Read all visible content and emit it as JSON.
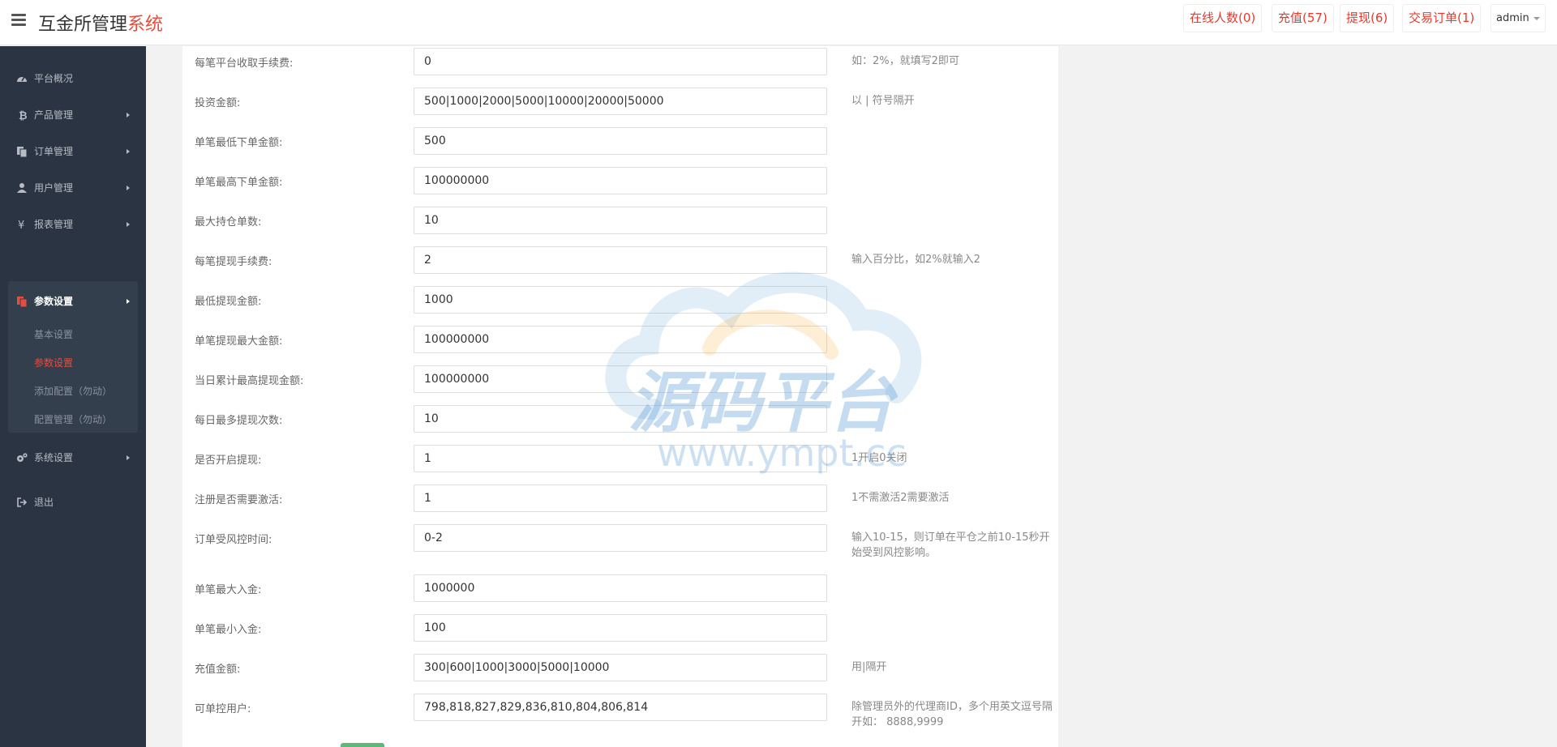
{
  "header": {
    "title_main": "互金所管理",
    "title_accent": "系统",
    "online_btn": "在线人数(0)",
    "recharge_btn": "充值(57)",
    "withdraw_btn": "提现(6)",
    "orders_btn": "交易订单(1)",
    "user_name": "admin"
  },
  "sidebar": {
    "items": [
      {
        "label": "平台概况",
        "icon": "dashboard-icon"
      },
      {
        "label": "产品管理",
        "icon": "bitcoin-icon"
      },
      {
        "label": "订单管理",
        "icon": "copy-icon"
      },
      {
        "label": "用户管理",
        "icon": "user-icon"
      },
      {
        "label": "报表管理",
        "icon": "yen-icon"
      },
      {
        "label": "参数设置",
        "icon": "copy-icon"
      },
      {
        "label": "系统设置",
        "icon": "gears-icon"
      },
      {
        "label": "退出",
        "icon": "sign-out-icon"
      }
    ],
    "sub_items": [
      {
        "label": "基本设置"
      },
      {
        "label": "参数设置"
      },
      {
        "label": "添加配置（勿动）"
      },
      {
        "label": "配置管理（勿动）"
      }
    ]
  },
  "form": {
    "rows": [
      {
        "label": "每笔平台收取手续费:",
        "value": "0",
        "hint": "如：2%，就填写2即可"
      },
      {
        "label": "投资金额:",
        "value": "500|1000|2000|5000|10000|20000|50000",
        "hint": "以 | 符号隔开"
      },
      {
        "label": "单笔最低下单金额:",
        "value": "500",
        "hint": ""
      },
      {
        "label": "单笔最高下单金额:",
        "value": "100000000",
        "hint": ""
      },
      {
        "label": "最大持仓单数:",
        "value": "10",
        "hint": ""
      },
      {
        "label": "每笔提现手续费:",
        "value": "2",
        "hint": "输入百分比，如2%就输入2"
      },
      {
        "label": "最低提现金额:",
        "value": "1000",
        "hint": ""
      },
      {
        "label": "单笔提现最大金额:",
        "value": "100000000",
        "hint": ""
      },
      {
        "label": "当日累计最高提现金额:",
        "value": "100000000",
        "hint": ""
      },
      {
        "label": "每日最多提现次数:",
        "value": "10",
        "hint": ""
      },
      {
        "label": "是否开启提现:",
        "value": "1",
        "hint": "1开启0关闭"
      },
      {
        "label": "注册是否需要激活:",
        "value": "1",
        "hint": "1不需激活2需要激活"
      },
      {
        "label": "订单受风控时间:",
        "value": "0-2",
        "hint": "输入10-15，则订单在平仓之前10-15秒开始受到风控影响。"
      },
      {
        "label": "单笔最大入金:",
        "value": "1000000",
        "hint": ""
      },
      {
        "label": "单笔最小入金:",
        "value": "100",
        "hint": ""
      },
      {
        "label": "充值金额:",
        "value": "300|600|1000|3000|5000|10000",
        "hint": "用|隔开"
      },
      {
        "label": "可单控用户:",
        "value": "798,818,827,829,836,810,804,806,814",
        "hint": "除管理员外的代理商ID，多个用英文逗号隔开如： 8888,9999"
      }
    ]
  },
  "watermark": {
    "title": "源码平台",
    "url": "www.ympt.cc"
  },
  "colors": {
    "accent": "#e84c3d",
    "sidebar_bg": "#2a3442",
    "submit_green": "#5fb878"
  }
}
